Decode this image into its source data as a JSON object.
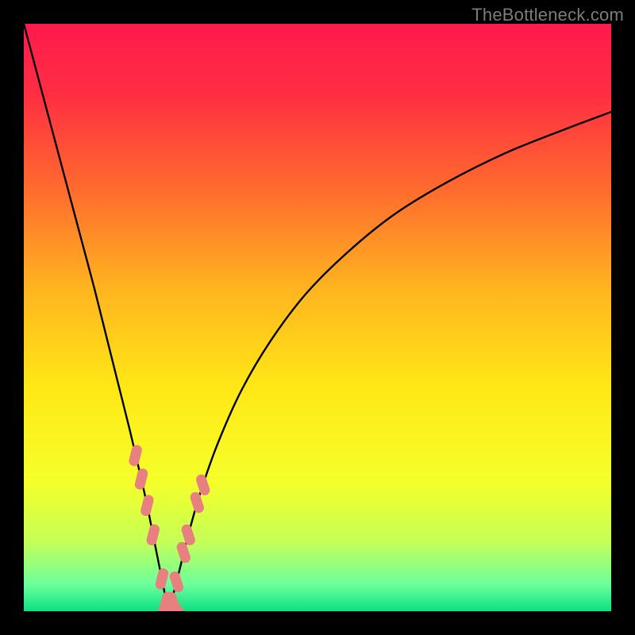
{
  "watermark": "TheBottleneck.com",
  "chart_data": {
    "type": "line",
    "title": "",
    "xlabel": "",
    "ylabel": "",
    "xlim": [
      0,
      100
    ],
    "ylim": [
      0,
      100
    ],
    "grid": false,
    "legend": false,
    "background_gradient_stops": [
      {
        "pos": 0.0,
        "color": "#ff1a4d"
      },
      {
        "pos": 0.12,
        "color": "#ff2e42"
      },
      {
        "pos": 0.28,
        "color": "#ff6a2e"
      },
      {
        "pos": 0.45,
        "color": "#ffb41f"
      },
      {
        "pos": 0.62,
        "color": "#ffe816"
      },
      {
        "pos": 0.78,
        "color": "#f5ff2a"
      },
      {
        "pos": 0.88,
        "color": "#c6ff56"
      },
      {
        "pos": 0.955,
        "color": "#6bff9c"
      },
      {
        "pos": 1.0,
        "color": "#0be082"
      }
    ],
    "curve_left": {
      "x": [
        0,
        2,
        4,
        6,
        8,
        10,
        12,
        14,
        16,
        18,
        20,
        21,
        22,
        23,
        24,
        24.7
      ],
      "y": [
        100,
        92.5,
        85,
        77.5,
        70,
        62.5,
        55,
        47,
        39,
        31,
        22.5,
        18,
        13,
        8,
        3,
        0
      ]
    },
    "curve_right": {
      "x": [
        24.7,
        26,
        27,
        28,
        30,
        33,
        37,
        42,
        48,
        55,
        63,
        72,
        82,
        92,
        100
      ],
      "y": [
        0,
        5,
        9,
        13,
        20,
        28.5,
        37.5,
        46,
        54,
        61,
        67.5,
        73,
        78,
        82,
        85
      ]
    },
    "left_markers": {
      "x": [
        19.0,
        20.0,
        21.0,
        22.0,
        23.5,
        24.2
      ],
      "y": [
        26.5,
        22.5,
        18,
        13,
        5.5,
        1.5
      ]
    },
    "right_markers": {
      "x": [
        25.4,
        26.0,
        27.2,
        28.0,
        29.5,
        30.5
      ],
      "y": [
        1.5,
        5.0,
        10,
        13,
        18.5,
        21.5
      ]
    },
    "bottom_markers": {
      "x": [
        24.5,
        25.5
      ],
      "y": [
        0.2,
        0.2
      ]
    }
  }
}
